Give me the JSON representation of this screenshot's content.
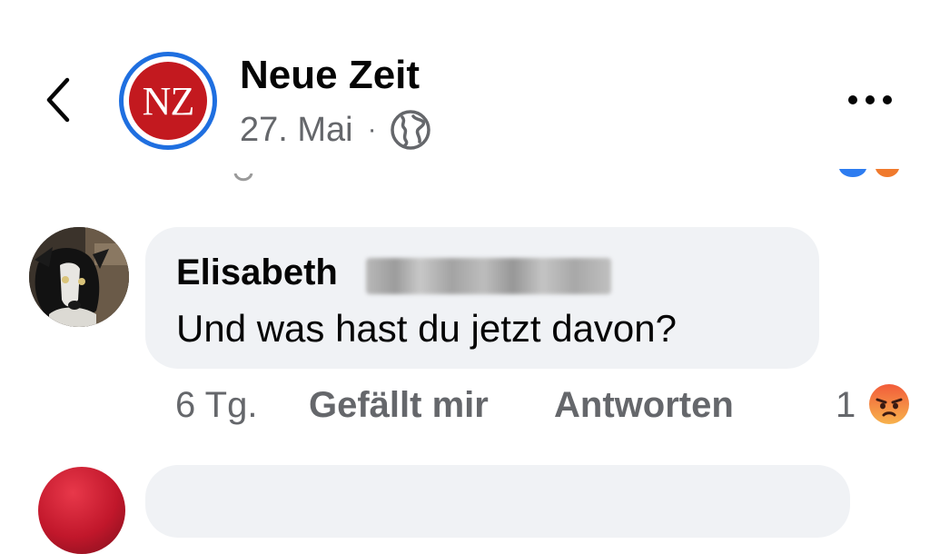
{
  "header": {
    "page_name": "Neue Zeit",
    "avatar_text": "NZ",
    "post_date": "27. Mai",
    "separator": "·",
    "audience_icon": "globe-icon",
    "back_icon": "chevron-left-icon",
    "more_icon": "more-horizontal-icon"
  },
  "comment": {
    "author_first_name": "Elisabeth",
    "author_last_name_blurred": true,
    "text": "Und was hast du jetzt davon?",
    "time": "6 Tg.",
    "like_label": "Gefällt mir",
    "reply_label": "Antworten",
    "reaction_count": "1",
    "reaction_icon": "angry-emoji-icon"
  },
  "colors": {
    "brand_red": "#c3191f",
    "brand_blue_ring": "#1f6fe0",
    "bubble_bg": "#f0f2f5",
    "secondary_text": "#65676b",
    "primary_text": "#050505"
  }
}
